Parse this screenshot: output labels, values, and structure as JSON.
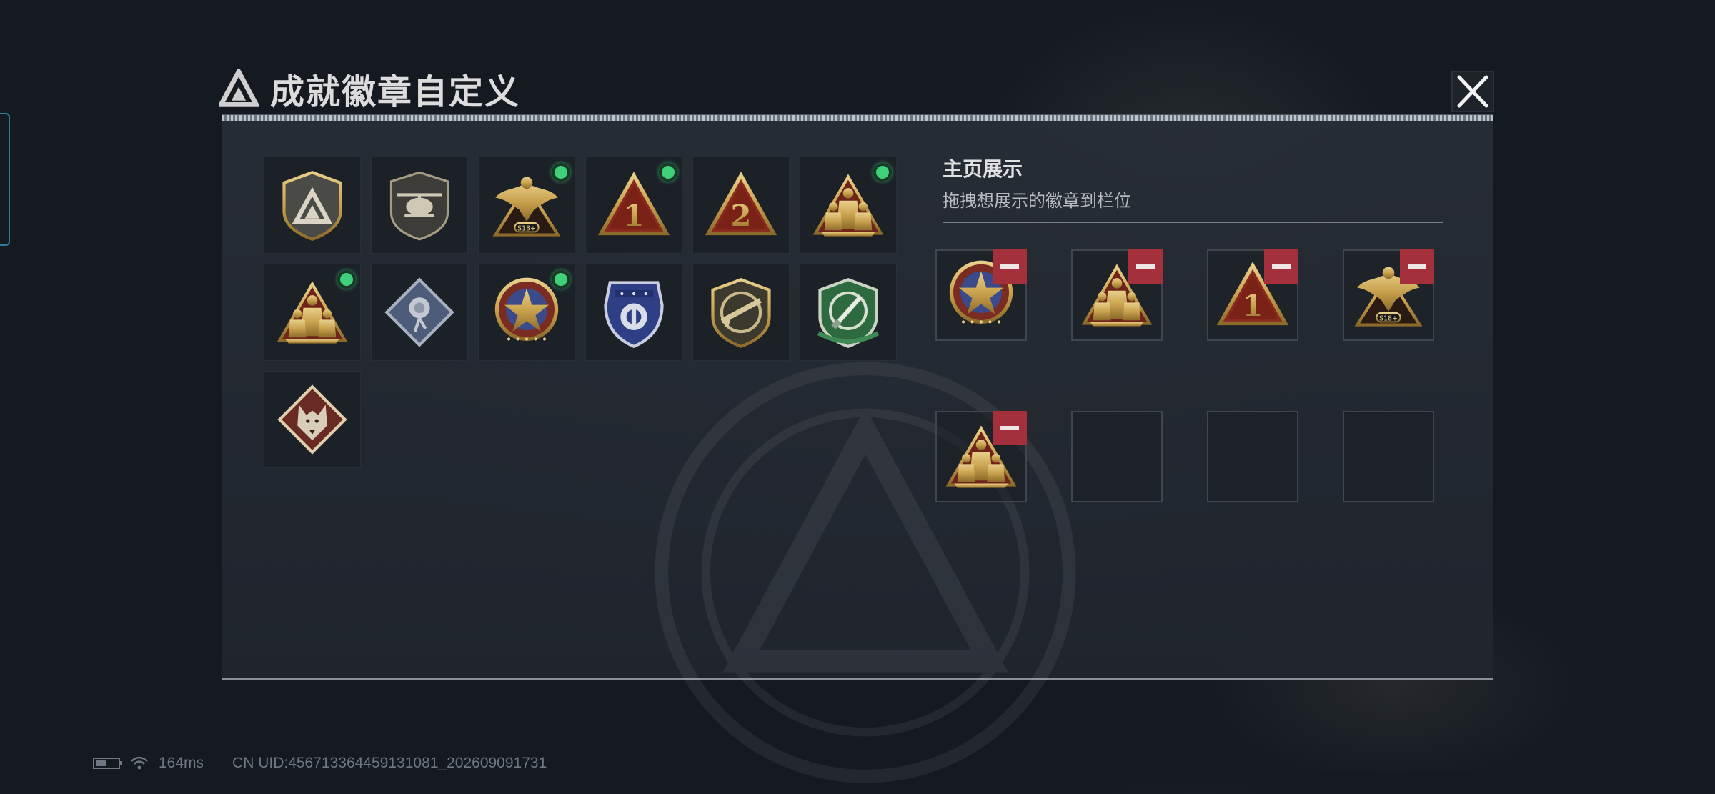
{
  "dialog": {
    "title": "成就徽章自定义",
    "close_icon": "close-icon"
  },
  "badges": [
    {
      "name": "shield-triangle-badge",
      "new": false
    },
    {
      "name": "helicopter-badge",
      "new": false
    },
    {
      "name": "eagle-s18-badge",
      "new": true
    },
    {
      "name": "rank-1-triangle-badge",
      "new": true
    },
    {
      "name": "rank-2-triangle-badge",
      "new": true
    },
    {
      "name": "soldiers-triangle-badge",
      "new": true
    },
    {
      "name": "soldiers-triangle-badge-2",
      "new": true
    },
    {
      "name": "rose-diamond-badge",
      "new": false
    },
    {
      "name": "star-medal-badge",
      "new": true
    },
    {
      "name": "blue-police-badge",
      "new": false
    },
    {
      "name": "rifle-shield-badge",
      "new": false
    },
    {
      "name": "green-knife-shield-badge",
      "new": false
    },
    {
      "name": "wolf-diamond-badge",
      "new": false
    }
  ],
  "showcase": {
    "title": "主页展示",
    "subtitle": "拖拽想展示的徽章到栏位",
    "slots": [
      {
        "badge": "star-medal-badge"
      },
      {
        "badge": "soldiers-triangle-badge"
      },
      {
        "badge": "rank-1-triangle-badge"
      },
      {
        "badge": "eagle-s18-badge"
      },
      {
        "badge": "soldiers-triangle-badge"
      },
      {
        "badge": null
      },
      {
        "badge": null
      },
      {
        "badge": null
      }
    ]
  },
  "status_bar": {
    "ping": "164ms",
    "uid": "CN UID:456713364459131081_202609091731"
  },
  "colors": {
    "new_dot": "#3fd07a",
    "remove_button": "#a3303a",
    "gold": "#c9a24e"
  }
}
